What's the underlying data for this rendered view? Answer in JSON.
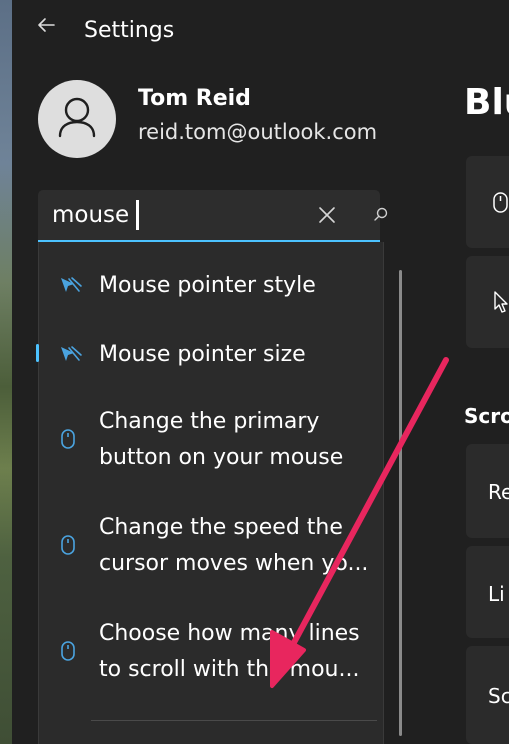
{
  "window": {
    "title": "Settings",
    "back_icon": "back-arrow-icon"
  },
  "profile": {
    "name": "Tom Reid",
    "email": "reid.tom@outlook.com",
    "avatar_icon": "person-icon"
  },
  "search": {
    "value": "mouse",
    "clear_icon": "close-icon",
    "search_icon": "search-icon",
    "accent": "#4cc2ff"
  },
  "results": [
    {
      "lines": [
        "Mouse pointer style"
      ],
      "icon": "mouse-pointer-icon"
    },
    {
      "lines": [
        "Mouse pointer size"
      ],
      "icon": "mouse-pointer-icon"
    },
    {
      "lines": [
        "Change the primary",
        "button on your mouse"
      ],
      "icon": "mouse-icon"
    },
    {
      "lines": [
        "Change the speed the",
        "cursor moves when yo..."
      ],
      "icon": "mouse-icon"
    },
    {
      "lines": [
        "Choose how many lines",
        "to scroll with the mou..."
      ],
      "icon": "mouse-icon"
    }
  ],
  "background_page": {
    "heading": "Blu",
    "section_heading": "Scro",
    "cards": [
      "",
      "",
      "Re",
      "Li",
      "Sc"
    ]
  },
  "colors": {
    "background": "#202020",
    "panel": "#2b2b2b",
    "accent": "#4cc2ff",
    "annotation_arrow": "#e8265e"
  }
}
